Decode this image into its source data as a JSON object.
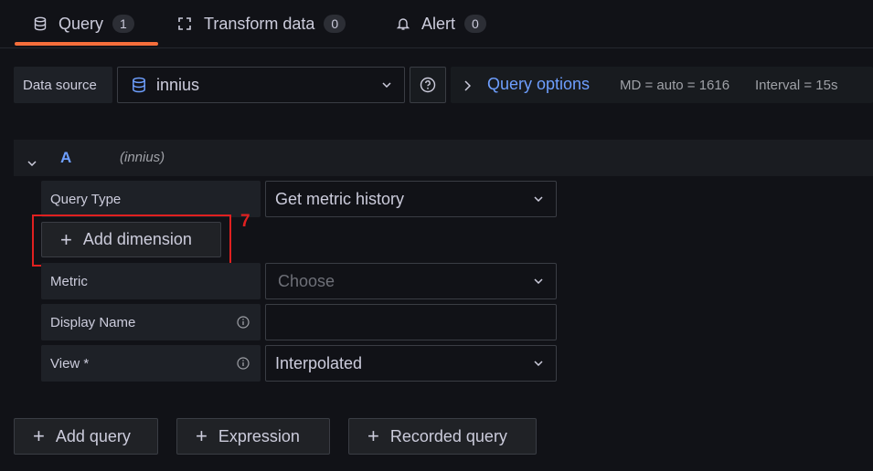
{
  "tabs": [
    {
      "label": "Query",
      "count": "1"
    },
    {
      "label": "Transform data",
      "count": "0"
    },
    {
      "label": "Alert",
      "count": "0"
    }
  ],
  "datasource": {
    "label": "Data source",
    "value": "innius",
    "query_options_label": "Query options",
    "md": "MD = auto = 1616",
    "interval": "Interval = 15s"
  },
  "query": {
    "refid": "A",
    "datasource_name": "(innius)",
    "query_type_label": "Query Type",
    "query_type_value": "Get metric history",
    "add_dimension_label": "Add dimension",
    "annotation_number": "7",
    "metric_label": "Metric",
    "metric_placeholder": "Choose",
    "display_name_label": "Display Name",
    "display_name_value": "",
    "view_label": "View *",
    "view_value": "Interpolated"
  },
  "footer": {
    "add_query": "Add query",
    "expression": "Expression",
    "recorded_query": "Recorded query"
  },
  "colors": {
    "accent": "#f56e3b",
    "link": "#6e9fff",
    "annotation": "#e02020"
  }
}
